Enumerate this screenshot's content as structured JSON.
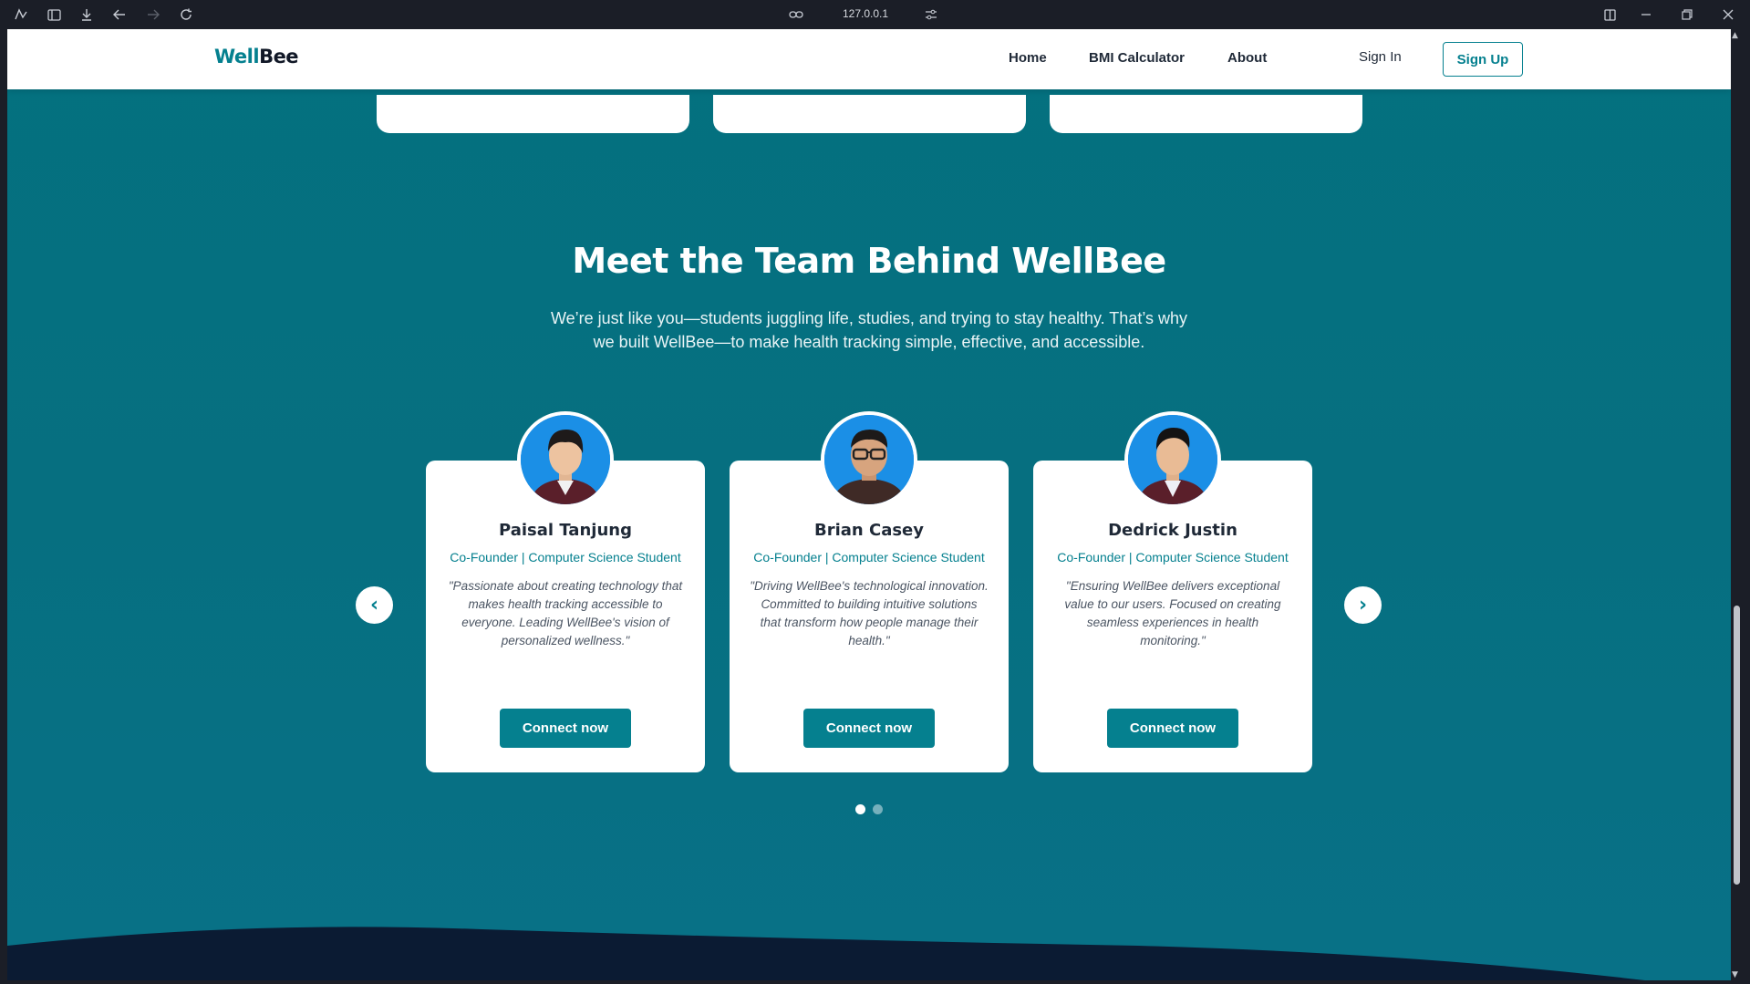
{
  "browser": {
    "url": "127.0.0.1"
  },
  "nav": {
    "logo_part1": "Well",
    "logo_part2": "Bee",
    "links": [
      "Home",
      "BMI Calculator",
      "About"
    ],
    "signin": "Sign In",
    "signup": "Sign Up"
  },
  "team": {
    "title": "Meet the Team Behind WellBee",
    "subtitle": "We’re just like you—students juggling life, studies, and trying to stay healthy. That’s why we built WellBee—to make health tracking simple, effective, and accessible.",
    "members": [
      {
        "name": "Paisal Tanjung",
        "role": "Co-Founder | Computer Science Student",
        "quote": "\"Passionate about creating technology that makes health tracking accessible to everyone. Leading WellBee's vision of personalized wellness.\"",
        "button": "Connect now"
      },
      {
        "name": "Brian Casey",
        "role": "Co-Founder | Computer Science Student",
        "quote": "\"Driving WellBee's technological innovation. Committed to building intuitive solutions that transform how people manage their health.\"",
        "button": "Connect now"
      },
      {
        "name": "Dedrick Justin",
        "role": "Co-Founder | Computer Science Student",
        "quote": "\"Ensuring WellBee delivers exceptional value to our users. Focused on creating seamless experiences in health monitoring.\"",
        "button": "Connect now"
      }
    ],
    "prev_arrow": "‹",
    "next_arrow": "›",
    "active_slide": 1,
    "slide_count": 2
  },
  "colors": {
    "brand": "#05808f",
    "section_bg": "#066f80",
    "footer": "#0b1b33"
  }
}
